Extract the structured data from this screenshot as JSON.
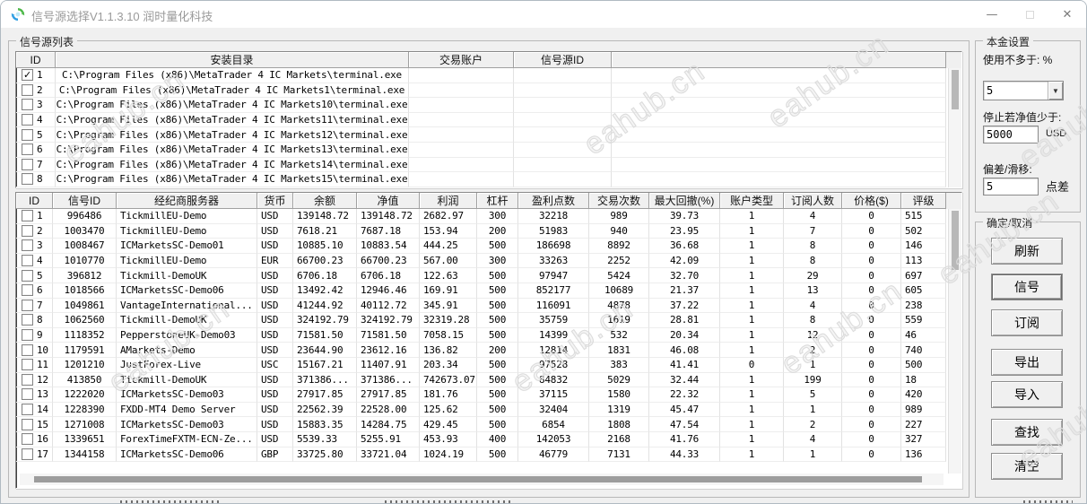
{
  "window": {
    "title": "信号源选择V1.1.3.10 润时量化科技"
  },
  "icons": {
    "minimize": "—",
    "close": "✕",
    "dropdown_arrow": "▼",
    "check": "✓"
  },
  "group_signal_list": {
    "label": "信号源列表"
  },
  "terminals_table": {
    "headers": [
      "ID",
      "安装目录",
      "交易账户",
      "信号源ID"
    ],
    "rows": [
      {
        "id": "1",
        "checked": true,
        "path": "C:\\Program Files (x86)\\MetaTrader 4 IC Markets\\terminal.exe",
        "account": "",
        "signal_id": ""
      },
      {
        "id": "2",
        "checked": false,
        "path": "C:\\Program Files (x86)\\MetaTrader 4 IC Markets1\\terminal.exe",
        "account": "",
        "signal_id": ""
      },
      {
        "id": "3",
        "checked": false,
        "path": "C:\\Program Files (x86)\\MetaTrader 4 IC Markets10\\terminal.exe",
        "account": "",
        "signal_id": ""
      },
      {
        "id": "4",
        "checked": false,
        "path": "C:\\Program Files (x86)\\MetaTrader 4 IC Markets11\\terminal.exe",
        "account": "",
        "signal_id": ""
      },
      {
        "id": "5",
        "checked": false,
        "path": "C:\\Program Files (x86)\\MetaTrader 4 IC Markets12\\terminal.exe",
        "account": "",
        "signal_id": ""
      },
      {
        "id": "6",
        "checked": false,
        "path": "C:\\Program Files (x86)\\MetaTrader 4 IC Markets13\\terminal.exe",
        "account": "",
        "signal_id": ""
      },
      {
        "id": "7",
        "checked": false,
        "path": "C:\\Program Files (x86)\\MetaTrader 4 IC Markets14\\terminal.exe",
        "account": "",
        "signal_id": ""
      },
      {
        "id": "8",
        "checked": false,
        "path": "C:\\Program Files (x86)\\MetaTrader 4 IC Markets15\\terminal.exe",
        "account": "",
        "signal_id": ""
      }
    ]
  },
  "signals_table": {
    "headers": [
      "ID",
      "信号ID",
      "经纪商服务器",
      "货币",
      "余额",
      "净值",
      "利润",
      "杠杆",
      "盈利点数",
      "交易次数",
      "最大回撤(%)",
      "账户类型",
      "订阅人数",
      "价格($)",
      "评级"
    ],
    "rows": [
      [
        "1",
        "996486",
        "TickmillEU-Demo",
        "USD",
        "139148.72",
        "139148.72",
        "2682.97",
        "300",
        "32218",
        "989",
        "39.73",
        "1",
        "4",
        "0",
        "515"
      ],
      [
        "2",
        "1003470",
        "TickmillEU-Demo",
        "USD",
        "7618.21",
        "7687.18",
        "153.94",
        "200",
        "51983",
        "940",
        "23.95",
        "1",
        "7",
        "0",
        "502"
      ],
      [
        "3",
        "1008467",
        "ICMarketsSC-Demo01",
        "USD",
        "10885.10",
        "10883.54",
        "444.25",
        "500",
        "186698",
        "8892",
        "36.68",
        "1",
        "8",
        "0",
        "146"
      ],
      [
        "4",
        "1010770",
        "TickmillEU-Demo",
        "EUR",
        "66700.23",
        "66700.23",
        "567.00",
        "300",
        "33263",
        "2252",
        "42.09",
        "1",
        "8",
        "0",
        "113"
      ],
      [
        "5",
        "396812",
        "Tickmill-DemoUK",
        "USD",
        "6706.18",
        "6706.18",
        "122.63",
        "500",
        "97947",
        "5424",
        "32.70",
        "1",
        "29",
        "0",
        "697"
      ],
      [
        "6",
        "1018566",
        "ICMarketsSC-Demo06",
        "USD",
        "13492.42",
        "12946.46",
        "169.91",
        "500",
        "852177",
        "10689",
        "21.37",
        "1",
        "13",
        "0",
        "605"
      ],
      [
        "7",
        "1049861",
        "VantageInternational...",
        "USD",
        "41244.92",
        "40112.72",
        "345.91",
        "500",
        "116091",
        "4878",
        "37.22",
        "1",
        "4",
        "0",
        "238"
      ],
      [
        "8",
        "1062560",
        "Tickmill-DemoUK",
        "USD",
        "324192.79",
        "324192.79",
        "32319.28",
        "500",
        "35759",
        "1619",
        "28.81",
        "1",
        "8",
        "0",
        "559"
      ],
      [
        "9",
        "1118352",
        "PepperstoneUK-Demo03",
        "USD",
        "71581.50",
        "71581.50",
        "7058.15",
        "500",
        "14399",
        "532",
        "20.34",
        "1",
        "12",
        "0",
        "46"
      ],
      [
        "10",
        "1179591",
        "AMarkets-Demo",
        "USD",
        "23644.90",
        "23612.16",
        "136.82",
        "200",
        "12814",
        "1831",
        "46.08",
        "1",
        "2",
        "0",
        "740"
      ],
      [
        "11",
        "1201210",
        "JustForex-Live",
        "USC",
        "15167.21",
        "11407.91",
        "203.34",
        "500",
        "97528",
        "383",
        "41.41",
        "0",
        "1",
        "0",
        "500"
      ],
      [
        "12",
        "413850",
        "Tickmill-DemoUK",
        "USD",
        "371386...",
        "371386...",
        "742673.07",
        "500",
        "84832",
        "5029",
        "32.44",
        "1",
        "199",
        "0",
        "18"
      ],
      [
        "13",
        "1222020",
        "ICMarketsSC-Demo03",
        "USD",
        "27917.85",
        "27917.85",
        "181.76",
        "500",
        "37115",
        "1580",
        "22.32",
        "1",
        "5",
        "0",
        "420"
      ],
      [
        "14",
        "1228390",
        "FXDD-MT4 Demo Server",
        "USD",
        "22562.39",
        "22528.00",
        "125.62",
        "500",
        "32404",
        "1319",
        "45.47",
        "1",
        "1",
        "0",
        "989"
      ],
      [
        "15",
        "1271008",
        "ICMarketsSC-Demo03",
        "USD",
        "15883.35",
        "14284.75",
        "429.45",
        "500",
        "6854",
        "1808",
        "47.54",
        "1",
        "2",
        "0",
        "227"
      ],
      [
        "16",
        "1339651",
        "ForexTimeFXTM-ECN-Ze...",
        "USD",
        "5539.33",
        "5255.91",
        "453.93",
        "400",
        "142053",
        "2168",
        "41.76",
        "1",
        "4",
        "0",
        "327"
      ],
      [
        "17",
        "1344158",
        "ICMarketsSC-Demo06",
        "GBP",
        "33725.80",
        "33721.04",
        "1024.19",
        "500",
        "46779",
        "7131",
        "44.33",
        "1",
        "1",
        "0",
        "136"
      ]
    ]
  },
  "capital_panel": {
    "label": "本金设置",
    "use_label": "使用不多于: %",
    "use_value": "5",
    "stop_label": "停止若净值少于:",
    "stop_value": "5000",
    "stop_unit": "USD",
    "slippage_label": "偏差/滑移:",
    "slippage_value": "5",
    "slippage_unit": "点差"
  },
  "action_panel": {
    "label": "确定/取消",
    "buttons": [
      "刷新",
      "信号",
      "订阅",
      "导出",
      "导入",
      "查找",
      "清空"
    ],
    "focused_index": 1
  },
  "watermark": {
    "text": "eahub.cn"
  }
}
